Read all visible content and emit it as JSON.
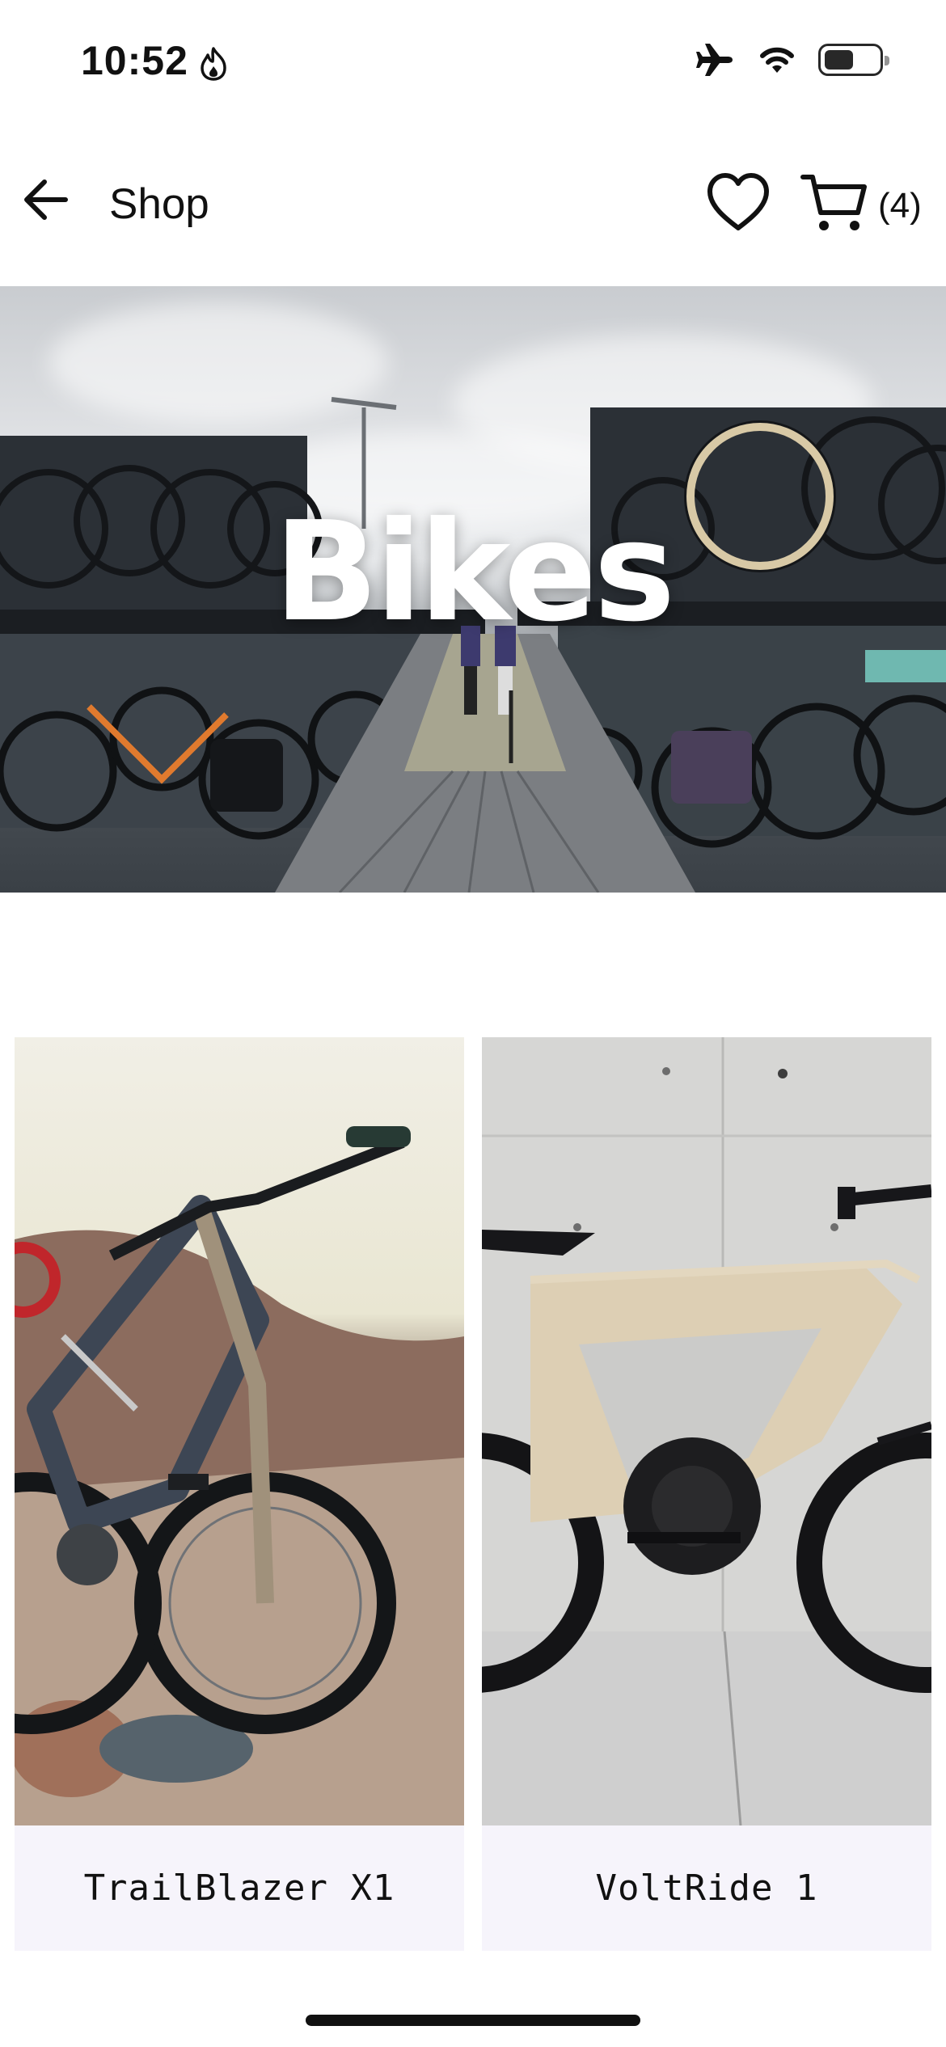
{
  "status_bar": {
    "time": "10:52",
    "icons": [
      "flame-icon",
      "airplane-icon",
      "wifi-icon",
      "battery-icon"
    ],
    "battery_level": 0.55
  },
  "header": {
    "back_icon": "arrow-left-icon",
    "title": "Shop",
    "favorites_icon": "heart-icon",
    "cart_icon": "cart-icon",
    "cart_count": "(4)"
  },
  "hero": {
    "title": "Bikes",
    "image": "bicycle-parking-photo"
  },
  "products": [
    {
      "name": "TrailBlazer X1",
      "image": "mountain-bike-photo"
    },
    {
      "name": "VoltRide 1",
      "image": "ebike-photo"
    }
  ],
  "colors": {
    "background": "#ffffff",
    "text": "#111111",
    "card_background": "#f6f4fb"
  }
}
